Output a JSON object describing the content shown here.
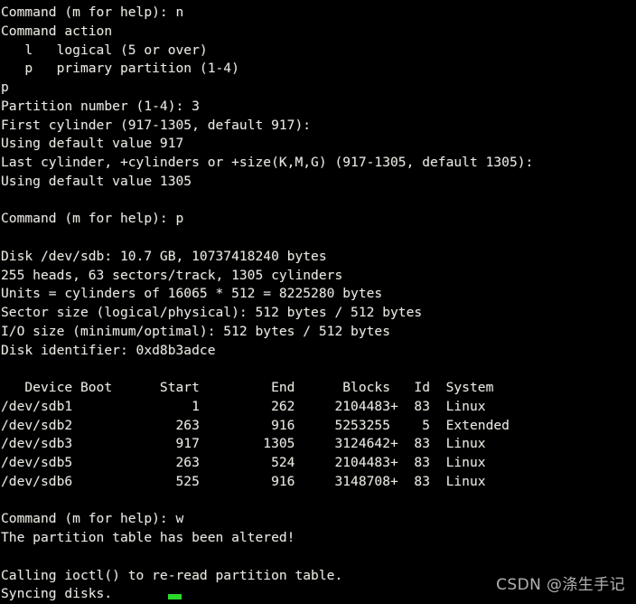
{
  "terminal": {
    "title": "fdisk partition session",
    "background_color": "#000000",
    "text_color": "#e9e7e1",
    "cursor_color": "#2bd82b",
    "lines": [
      "Command (m for help): n",
      "Command action",
      "   l   logical (5 or over)",
      "   p   primary partition (1-4)",
      "p",
      "Partition number (1-4): 3",
      "First cylinder (917-1305, default 917):",
      "Using default value 917",
      "Last cylinder, +cylinders or +size(K,M,G) (917-1305, default 1305):",
      "Using default value 1305",
      "",
      "Command (m for help): p",
      "",
      "Disk /dev/sdb: 10.7 GB, 10737418240 bytes",
      "255 heads, 63 sectors/track, 1305 cylinders",
      "Units = cylinders of 16065 * 512 = 8225280 bytes",
      "Sector size (logical/physical): 512 bytes / 512 bytes",
      "I/O size (minimum/optimal): 512 bytes / 512 bytes",
      "Disk identifier: 0xd8b3adce",
      "",
      "   Device Boot      Start         End      Blocks   Id  System",
      "/dev/sdb1               1         262     2104483+  83  Linux",
      "/dev/sdb2             263         916     5253255    5  Extended",
      "/dev/sdb3             917        1305     3124642+  83  Linux",
      "/dev/sdb5             263         524     2104483+  83  Linux",
      "/dev/sdb6             525         916     3148708+  83  Linux",
      "",
      "Command (m for help): w",
      "The partition table has been altered!",
      "",
      "Calling ioctl() to re-read partition table.",
      "Syncing disks."
    ],
    "prompts": {
      "command_prompt": "Command (m for help):",
      "new_partition_key": "n",
      "print_key": "p",
      "write_key": "w",
      "primary_choice": "p",
      "partition_number": "3"
    },
    "command_action_menu": [
      {
        "key": "l",
        "label": "logical (5 or over)"
      },
      {
        "key": "p",
        "label": "primary partition (1-4)"
      }
    ],
    "disk_info": {
      "device": "/dev/sdb",
      "size_human": "10.7 GB",
      "size_bytes": "10737418240 bytes",
      "heads": "255",
      "sectors_per_track": "63",
      "cylinders": "1305",
      "units": "cylinders of 16065 * 512 = 8225280 bytes",
      "sector_size": "512 bytes / 512 bytes",
      "io_size": "512 bytes / 512 bytes",
      "identifier": "0xd8b3adce"
    },
    "partition_table": {
      "headers": [
        "Device Boot",
        "Start",
        "End",
        "Blocks",
        "Id",
        "System"
      ],
      "rows": [
        {
          "device": "/dev/sdb1",
          "boot": "",
          "start": "1",
          "end": "262",
          "blocks": "2104483+",
          "id": "83",
          "system": "Linux"
        },
        {
          "device": "/dev/sdb2",
          "boot": "",
          "start": "263",
          "end": "916",
          "blocks": "5253255",
          "id": "5",
          "system": "Extended"
        },
        {
          "device": "/dev/sdb3",
          "boot": "",
          "start": "917",
          "end": "1305",
          "blocks": "3124642+",
          "id": "83",
          "system": "Linux"
        },
        {
          "device": "/dev/sdb5",
          "boot": "",
          "start": "263",
          "end": "524",
          "blocks": "2104483+",
          "id": "83",
          "system": "Linux"
        },
        {
          "device": "/dev/sdb6",
          "boot": "",
          "start": "525",
          "end": "916",
          "blocks": "3148708+",
          "id": "83",
          "system": "Linux"
        }
      ]
    },
    "messages": {
      "altered": "The partition table has been altered!",
      "ioctl": "Calling ioctl() to re-read partition table.",
      "syncing": "Syncing disks."
    }
  },
  "watermark": {
    "text": "CSDN @涤生手记"
  }
}
